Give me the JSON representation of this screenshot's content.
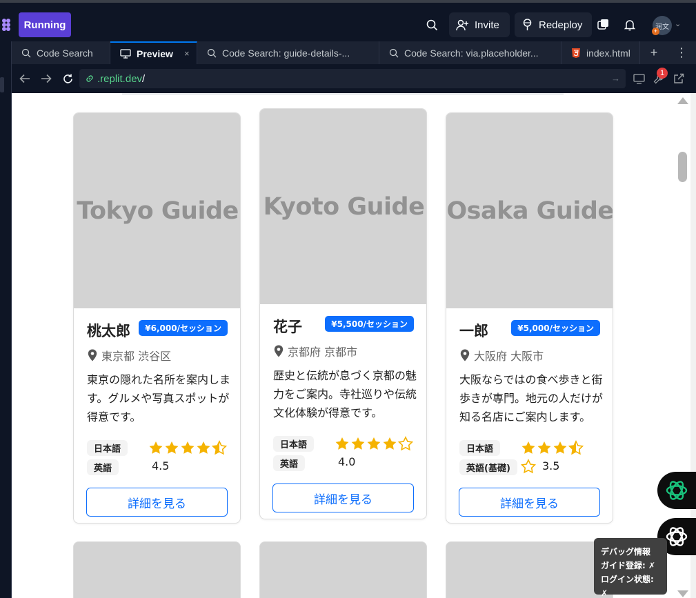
{
  "topbar": {
    "running_label": "Running",
    "invite_label": "Invite",
    "redeploy_label": "Redeploy",
    "avatar_text": "润文",
    "avatar_badge": "+"
  },
  "tabs": [
    {
      "label": "Code Search",
      "icon": "search-icon"
    },
    {
      "label": "Preview",
      "icon": "monitor-icon",
      "close": "×"
    },
    {
      "label": "Code Search: guide-details-...",
      "icon": "search-icon"
    },
    {
      "label": "Code Search: via.placeholder...",
      "icon": "search-icon"
    },
    {
      "label": "index.html",
      "icon": "html5-icon"
    }
  ],
  "tab_add": "+",
  "tab_more": "⋮",
  "urlbar": {
    "domain": ".replit.dev",
    "path": "/",
    "devtools_badge": "1"
  },
  "cards": [
    {
      "image_text": "Tokyo Guide",
      "name": "桃太郎",
      "price": "¥6,000/セッション",
      "location": "東京都 渋谷区",
      "description": "東京の隠れた名所を案内します。グルメや写真スポットが得意です。",
      "languages": [
        "日本語",
        "英語"
      ],
      "rating": 4.5,
      "rating_text": "4.5",
      "button": "詳細を見る"
    },
    {
      "image_text": "Kyoto Guide",
      "name": "花子",
      "price": "¥5,500/セッション",
      "location": "京都府 京都市",
      "description": "歴史と伝統が息づく京都の魅力をご案内。寺社巡りや伝統文化体験が得意です。",
      "languages": [
        "日本語",
        "英語"
      ],
      "rating": 4.0,
      "rating_text": "4.0",
      "button": "詳細を見る"
    },
    {
      "image_text": "Osaka Guide",
      "name": "一郎",
      "price": "¥5,000/セッション",
      "location": "大阪府 大阪市",
      "description": "大阪ならではの食べ歩きと街歩きが専門。地元の人だけが知る名店にご案内します。",
      "languages": [
        "日本語",
        "英語(基礎)"
      ],
      "rating": 3.5,
      "rating_text": "3.5",
      "button": "詳細を見る"
    }
  ],
  "debug": {
    "title": "デバッグ情報",
    "guide_line": "ガイド登録: ✗",
    "login_line": "ログイン状態: ✗"
  },
  "colors": {
    "accent": "#0d6efd",
    "running": "#5a3fd6",
    "star": "#f5b301",
    "ide_bg": "#0e1525"
  }
}
